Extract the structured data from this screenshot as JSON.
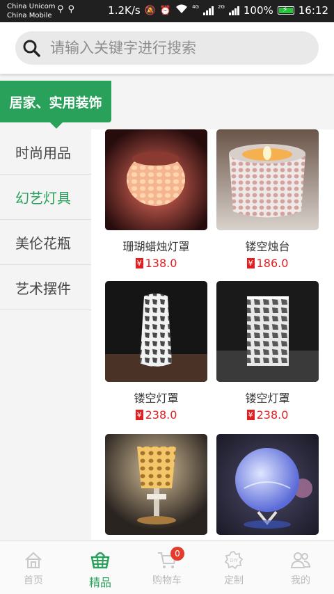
{
  "statusbar": {
    "carrier1": "China Unicom",
    "carrier2": "China Mobile",
    "speed": "1.2K/s",
    "net4g": "4G",
    "net2g": "2G",
    "battery": "100%",
    "time": "16:12"
  },
  "search": {
    "placeholder": "请输入关键字进行搜索"
  },
  "category_tab": "居家、实用装饰",
  "sidebar": {
    "items": [
      {
        "label": "时尚用品",
        "active": false
      },
      {
        "label": "幻艺灯具",
        "active": true
      },
      {
        "label": "美伦花瓶",
        "active": false
      },
      {
        "label": "艺术摆件",
        "active": false
      }
    ]
  },
  "products": [
    {
      "name": "珊瑚蜡烛灯罩",
      "currency": "¥",
      "price": "138.0"
    },
    {
      "name": "镂空烛台",
      "currency": "¥",
      "price": "186.0"
    },
    {
      "name": "镂空灯罩",
      "currency": "¥",
      "price": "238.0"
    },
    {
      "name": "镂空灯罩",
      "currency": "¥",
      "price": "238.0"
    },
    {
      "name": "",
      "currency": "",
      "price": ""
    },
    {
      "name": "",
      "currency": "",
      "price": ""
    }
  ],
  "bottomnav": {
    "items": [
      {
        "label": "首页",
        "icon": "home-icon"
      },
      {
        "label": "精品",
        "icon": "basket-icon"
      },
      {
        "label": "购物车",
        "icon": "cart-icon",
        "badge": "0"
      },
      {
        "label": "定制",
        "icon": "diy-icon"
      },
      {
        "label": "我的",
        "icon": "user-icon"
      }
    ]
  },
  "colors": {
    "accent": "#29a15a",
    "price": "#e02020",
    "badge": "#e53a2e"
  }
}
